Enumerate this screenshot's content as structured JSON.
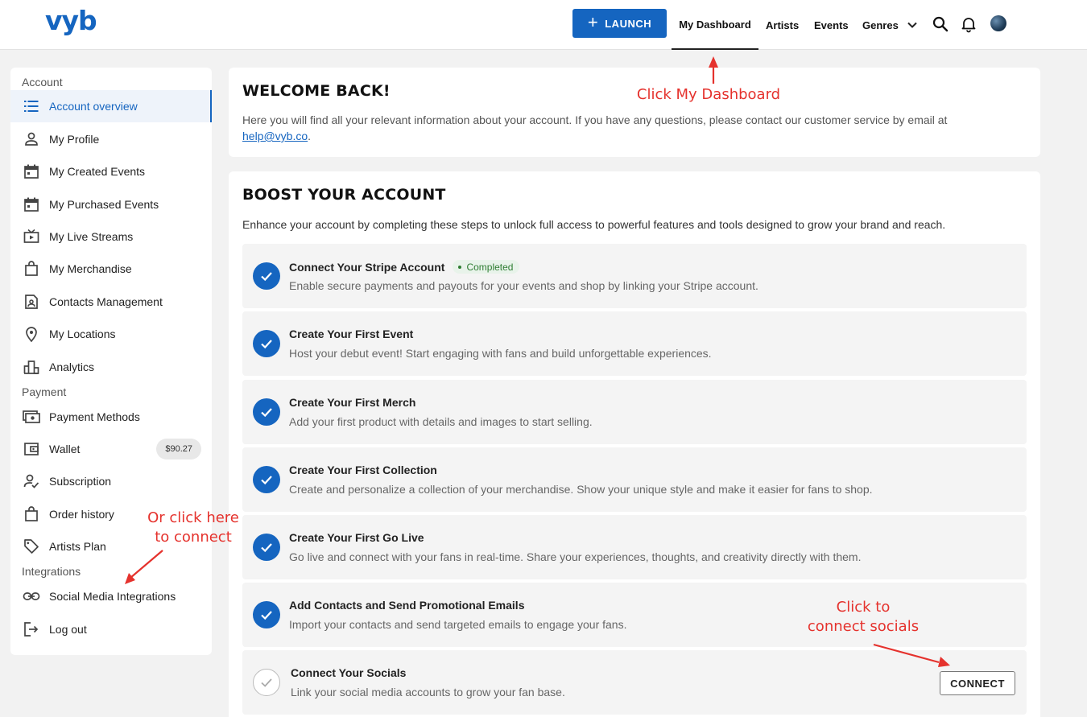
{
  "brand": {
    "logo": "vyb",
    "accent": "#1565c0"
  },
  "header": {
    "launch_label": "LAUNCH",
    "nav": {
      "dashboard": "My Dashboard",
      "artists": "Artists",
      "events": "Events",
      "genres": "Genres"
    },
    "icons": [
      "search-icon",
      "bell-icon",
      "avatar"
    ]
  },
  "annotations": {
    "dashboard": "Click My Dashboard",
    "sidebar_line1": "Or click here",
    "sidebar_line2": "to connect",
    "connect_line1": "Click to",
    "connect_line2": "connect socials",
    "color": "#e5322d"
  },
  "sidebar": {
    "account_heading": "Account",
    "payment_heading": "Payment",
    "integrations_heading": "Integrations",
    "items": [
      {
        "label": "Account overview",
        "icon": "list-icon"
      },
      {
        "label": "My Profile",
        "icon": "person-icon"
      },
      {
        "label": "My Created Events",
        "icon": "calendar-icon"
      },
      {
        "label": "My Purchased Events",
        "icon": "calendar-icon"
      },
      {
        "label": "My Live Streams",
        "icon": "tv-icon"
      },
      {
        "label": "My Merchandise",
        "icon": "bag-icon"
      },
      {
        "label": "Contacts Management",
        "icon": "contact-icon"
      },
      {
        "label": "My Locations",
        "icon": "location-pin-icon"
      },
      {
        "label": "Analytics",
        "icon": "analytics-icon"
      },
      {
        "label": "Payment Methods",
        "icon": "payment-icon"
      },
      {
        "label": "Wallet",
        "icon": "wallet-icon",
        "badge": "$90.27"
      },
      {
        "label": "Subscription",
        "icon": "subscription-icon"
      },
      {
        "label": "Order history",
        "icon": "bag-icon"
      },
      {
        "label": "Artists Plan",
        "icon": "tag-icon"
      },
      {
        "label": "Social Media Integrations",
        "icon": "link-icon"
      },
      {
        "label": "Log out",
        "icon": "logout-icon"
      }
    ]
  },
  "welcome": {
    "title": "WELCOME BACK!",
    "text": "Here you will find all your relevant information about your account. If you have any questions, please contact our customer service by email at",
    "email": "help@vyb.co"
  },
  "boost": {
    "title": "BOOST YOUR ACCOUNT",
    "subtitle": "Enhance your account by completing these steps to unlock full access to powerful features and tools designed to grow your brand and reach.",
    "completed_label": "Completed",
    "connect_label": "CONNECT",
    "steps": [
      {
        "title": "Connect Your Stripe Account",
        "desc": "Enable secure payments and payouts for your events and shop by linking your Stripe account.",
        "done": true
      },
      {
        "title": "Create Your First Event",
        "desc": "Host your debut event! Start engaging with fans and build unforgettable experiences.",
        "done": true
      },
      {
        "title": "Create Your First Merch",
        "desc": "Add your first product with details and images to start selling.",
        "done": true
      },
      {
        "title": "Create Your First Collection",
        "desc": "Create and personalize a collection of your merchandise. Show your unique style and make it easier for fans to shop.",
        "done": true
      },
      {
        "title": "Create Your First Go Live",
        "desc": "Go live and connect with your fans in real-time. Share your experiences, thoughts, and creativity directly with them.",
        "done": true
      },
      {
        "title": "Add Contacts and Send Promotional Emails",
        "desc": "Import your contacts and send targeted emails to engage your fans.",
        "done": true
      },
      {
        "title": "Connect Your Socials",
        "desc": "Link your social media accounts to grow your fan base.",
        "done": false
      }
    ]
  }
}
